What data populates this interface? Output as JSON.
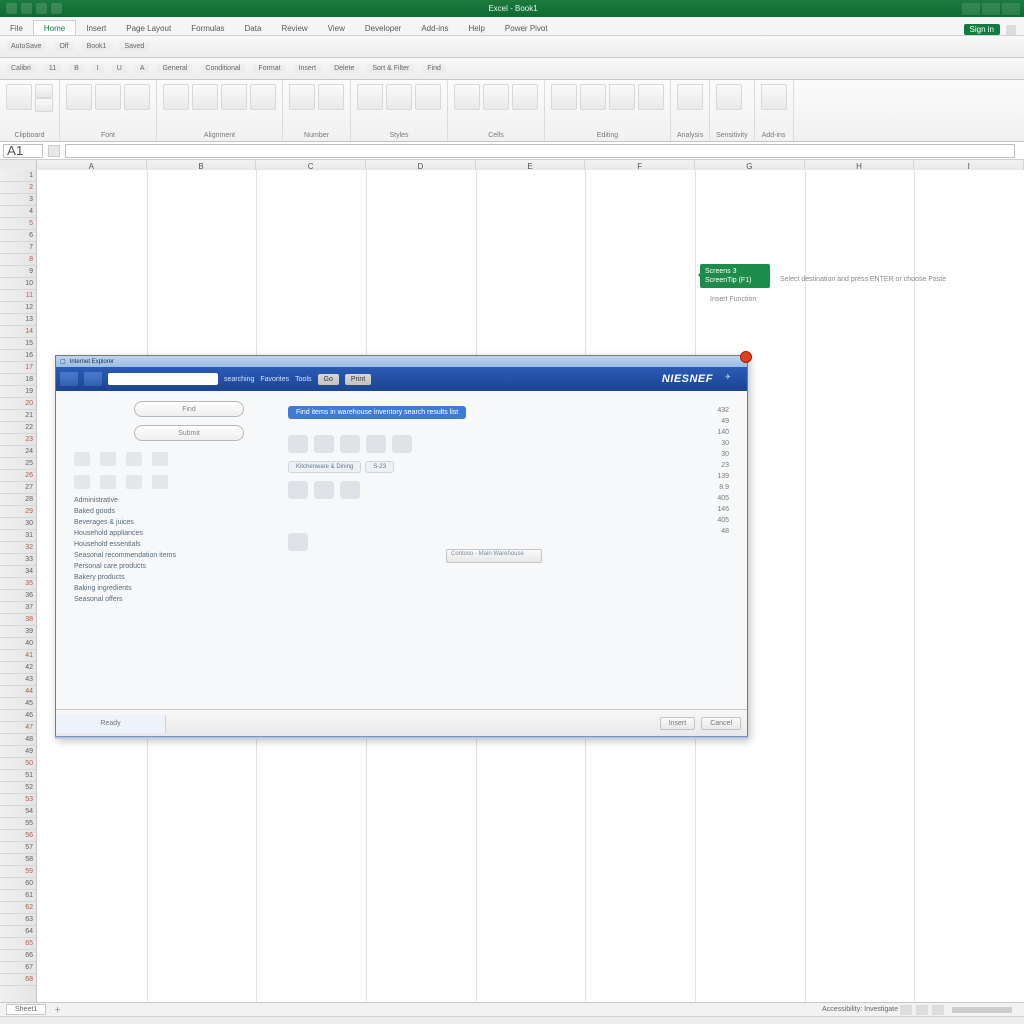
{
  "title": {
    "doc": "Excel - Book1"
  },
  "tabs": [
    "File",
    "Home",
    "Insert",
    "Page Layout",
    "Formulas",
    "Data",
    "Review",
    "View",
    "Developer",
    "Add-ins",
    "Help",
    "Power Pivot"
  ],
  "activeTab": 1,
  "signIn": "Sign in",
  "panel1": [
    "AutoSave",
    "Off",
    "Book1",
    "Saved"
  ],
  "panel2": [
    "Calibri",
    "11",
    "B",
    "I",
    "U",
    "A",
    "General",
    "Conditional",
    "Format",
    "Insert",
    "Delete",
    "Sort & Filter",
    "Find"
  ],
  "groups": [
    "Clipboard",
    "Font",
    "Alignment",
    "Number",
    "Styles",
    "Cells",
    "Editing",
    "Analysis",
    "Sensitivity",
    "Add-ins"
  ],
  "namebox": "A1",
  "formula": "",
  "fxcaption": "",
  "cols": [
    "A",
    "B",
    "C",
    "D",
    "E",
    "F",
    "G",
    "H",
    "I"
  ],
  "rowstart": 1,
  "rowcount": 68,
  "greentag": {
    "l1": "Screens 3",
    "l2": "ScreenTip (F1)"
  },
  "hint": "Select destination and press ENTER or choose Paste",
  "hint2": "Insert Function",
  "dlg": {
    "title": "Internet Explorer",
    "nav": {
      "back": "Back",
      "fwd": "Forward",
      "addr": "",
      "stat": "searching",
      "menu1": "Favorites",
      "menu2": "Tools",
      "btn": "Go",
      "plugin": "Print",
      "brand": "NIESNEF"
    },
    "input1": "Find",
    "input2": "Submit",
    "pill": "Find items in warehouse inventory search results list",
    "chips": [
      "Kitchenware & Dining",
      "S-23"
    ],
    "ddrop": "Contoso - Main Warehouse",
    "cats": [
      "Administrative",
      "Baked goods",
      "Beverages & juices",
      "Household appliances",
      "Household essentials",
      "Seasonal recommendation items",
      "Personal care products",
      "Bakery products",
      "Baking ingredients",
      "Seasonal offers"
    ],
    "vals": [
      "432",
      "49",
      "140",
      "30",
      "30",
      "23",
      "139",
      "8.9",
      "405",
      "146",
      "405",
      "48"
    ],
    "footer": {
      "tab": "Ready",
      "ok": "Insert",
      "cancel": "Cancel"
    }
  },
  "sheet": {
    "tabs": [
      "Sheet1"
    ],
    "info": "Accessibility: Investigate"
  }
}
